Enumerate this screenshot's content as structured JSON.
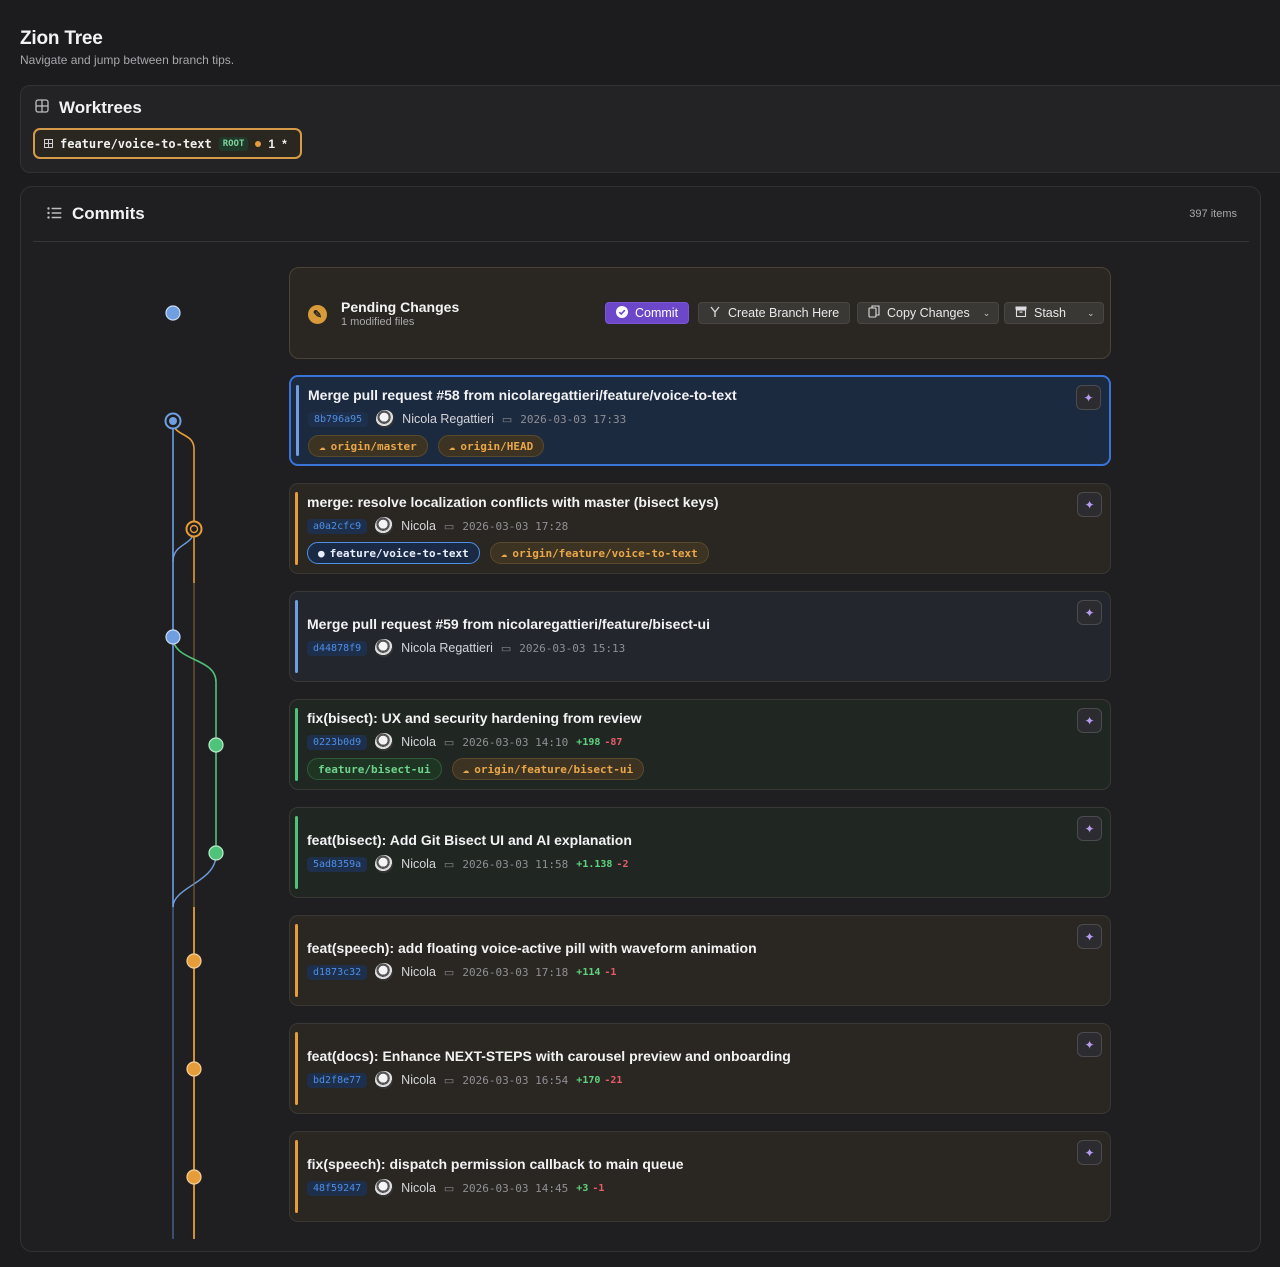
{
  "app": {
    "title": "Zion Tree",
    "subtitle": "Navigate and jump between branch tips."
  },
  "worktrees": {
    "heading": "Worktrees",
    "chip": {
      "branch": "feature/voice-to-text",
      "badge": "ROOT",
      "changes": "1",
      "marker": "*"
    }
  },
  "commits": {
    "heading": "Commits",
    "count": "397 items",
    "pending": {
      "title": "Pending Changes",
      "subtitle": "1 modified files",
      "commit_label": "Commit",
      "create_branch_label": "Create Branch Here",
      "copy_changes_label": "Copy Changes",
      "stash_label": "Stash"
    },
    "list": [
      {
        "message": "Merge pull request #58 from nicolaregattieri/feature/voice-to-text",
        "hash": "8b796a95",
        "author": "Nicola Regattieri",
        "date": "2026-03-03 17:33",
        "tags": [
          "origin/master",
          "origin/HEAD"
        ]
      },
      {
        "message": "merge: resolve localization conflicts with master (bisect keys)",
        "hash": "a0a2cfc9",
        "author": "Nicola",
        "date": "2026-03-03 17:28",
        "tags": [
          "feature/voice-to-text",
          "origin/feature/voice-to-text"
        ]
      },
      {
        "message": "Merge pull request #59 from nicolaregattieri/feature/bisect-ui",
        "hash": "d44878f9",
        "author": "Nicola Regattieri",
        "date": "2026-03-03 15:13"
      },
      {
        "message": "fix(bisect): UX and security hardening from review",
        "hash": "0223b0d9",
        "author": "Nicola",
        "date": "2026-03-03 14:10",
        "added": "+198",
        "removed": "-87",
        "tags": [
          "feature/bisect-ui",
          "origin/feature/bisect-ui"
        ]
      },
      {
        "message": "feat(bisect): Add Git Bisect UI and AI explanation",
        "hash": "5ad8359a",
        "author": "Nicola",
        "date": "2026-03-03 11:58",
        "added": "+1.138",
        "removed": "-2"
      },
      {
        "message": "feat(speech): add floating voice-active pill with waveform animation",
        "hash": "d1873c32",
        "author": "Nicola",
        "date": "2026-03-03 17:18",
        "added": "+114",
        "removed": "-1"
      },
      {
        "message": "feat(docs): Enhance NEXT-STEPS with carousel preview and onboarding",
        "hash": "bd2f8e77",
        "author": "Nicola",
        "date": "2026-03-03 16:54",
        "added": "+170",
        "removed": "-21"
      },
      {
        "message": "fix(speech): dispatch permission callback to main queue",
        "hash": "48f59247",
        "author": "Nicola",
        "date": "2026-03-03 14:45",
        "added": "+3",
        "removed": "-1"
      }
    ]
  },
  "colors": {
    "blue": "#6f9fe0",
    "orange": "#e79c3a",
    "green": "#4fc37a",
    "accent": "#6c47c9"
  }
}
